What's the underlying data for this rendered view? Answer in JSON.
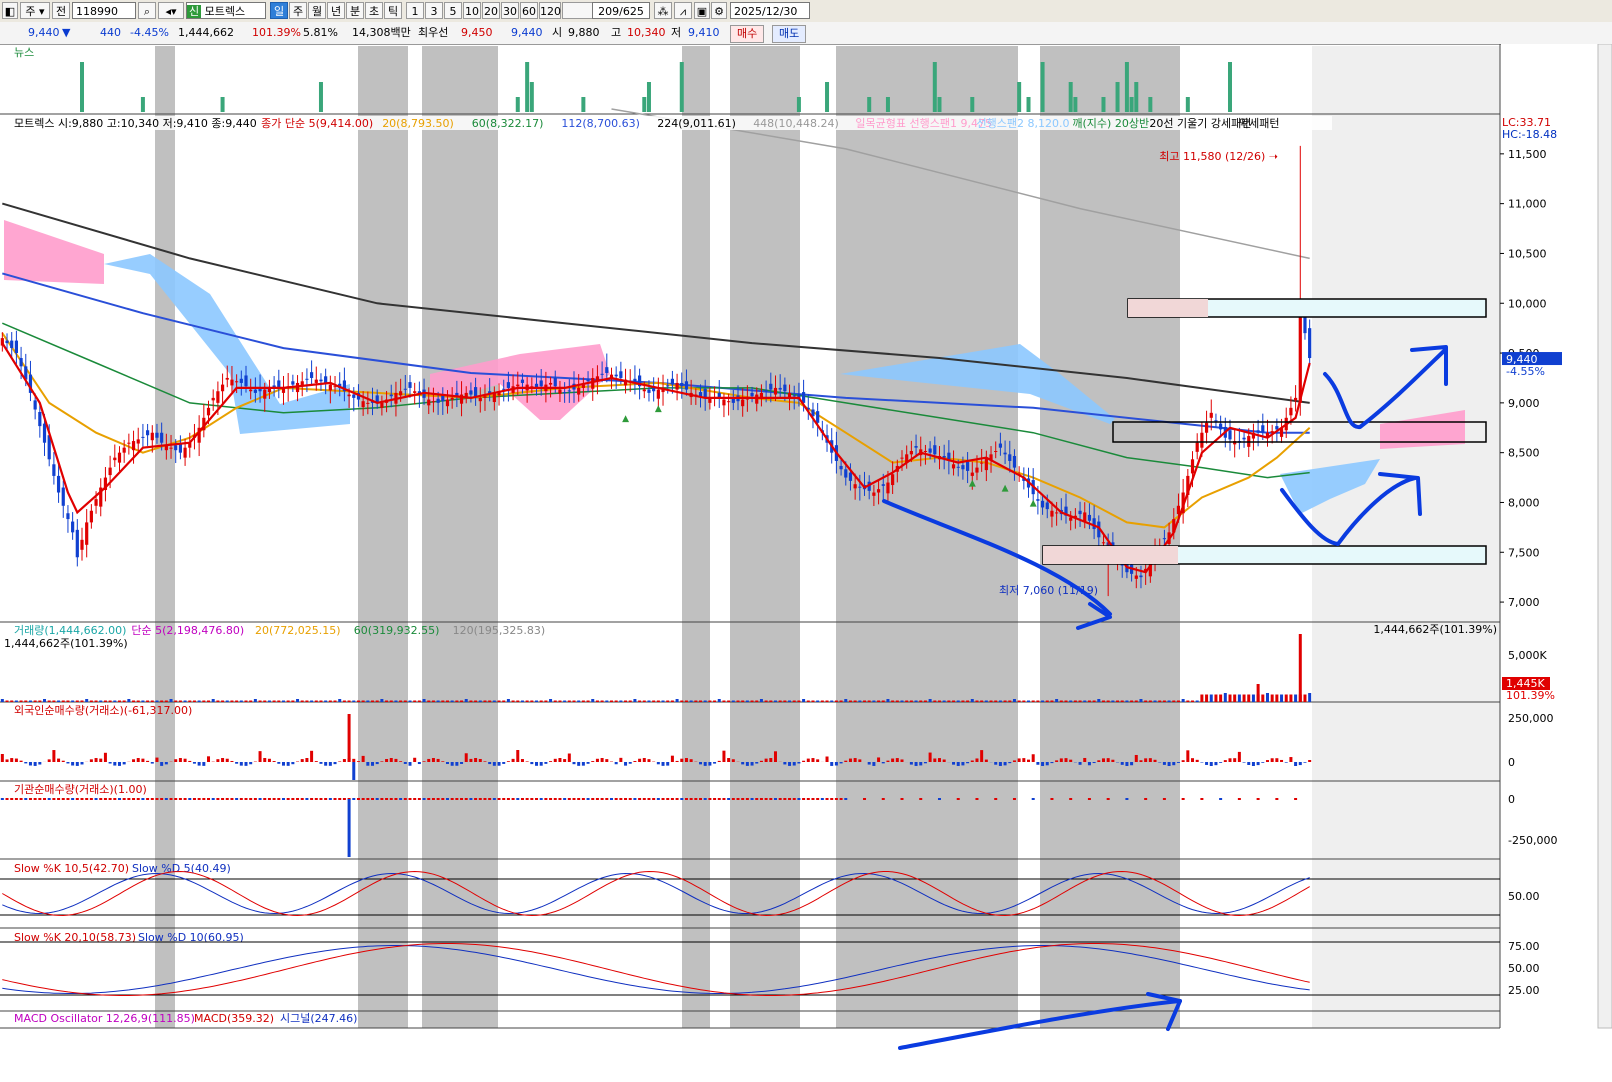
{
  "toolbar": {
    "items": [
      "주",
      "전",
      "118990",
      "모트렉스",
      "일",
      "주",
      "월",
      "년",
      "분",
      "초",
      "틱",
      "1",
      "3",
      "5",
      "10",
      "20",
      "30",
      "60",
      "120"
    ],
    "code": "118990",
    "name": "모트렉스",
    "name_prefix": "신",
    "periods": [
      "일",
      "주",
      "월",
      "년",
      "분",
      "초",
      "틱"
    ],
    "intervals": [
      "1",
      "3",
      "5",
      "10",
      "20",
      "30",
      "60",
      "120"
    ],
    "count": "209/625",
    "date": "2025/12/30"
  },
  "quote": {
    "price": "9,440",
    "change": "440",
    "change_pct": "-4.45%",
    "volume": "1,444,662",
    "vol_ratio": "101.39%",
    "turnover_pct": "5.81%",
    "amount": "14,308백만",
    "best_ask_label": "최우선",
    "best_ask": "9,450",
    "best_bid": "9,440",
    "open_label": "시",
    "open": "9,880",
    "high_label": "고",
    "high": "10,340",
    "low_label": "저",
    "low": "9,410",
    "buy": "매수",
    "sell": "매도"
  },
  "panels": {
    "news": "뉴스",
    "price_legend": [
      {
        "text": "모트렉스 시:9,880 고:10,340 저:9,410 종:9,440",
        "color": "#000000"
      },
      {
        "text": "종가 단순 5(9,414.00)",
        "color": "#d00000"
      },
      {
        "text": "20(8,793.50)",
        "color": "#e8a000"
      },
      {
        "text": "60(8,322.17)",
        "color": "#1a8a3a"
      },
      {
        "text": "112(8,700.63)",
        "color": "#2a4fd8"
      },
      {
        "text": "224(9,011.61)",
        "color": "#000000"
      },
      {
        "text": "448(10,448.24)",
        "color": "#999999"
      },
      {
        "text": "일목균형표 선행스팬1 9,475",
        "color": "#ff9ccc"
      },
      {
        "text": "선행스팬2 8,120.0",
        "color": "#8cc8ff"
      },
      {
        "text": "깨(지수) 20상반",
        "color": "#1a8a3a"
      },
      {
        "text": "20선 기울기 강세패턴",
        "color": "#000000"
      },
      {
        "text": "약세패턴",
        "color": "#000000"
      }
    ],
    "high_note": "최고 11,580 (12/26)",
    "low_note": "최저 7,060 (11/19)",
    "lc": "LC:33.71",
    "hc": "HC:-18.48",
    "price_tag": "9,440",
    "price_tag_pct": "-4.55%",
    "volume_legend": [
      {
        "text": "거래량(1,444,662.00)",
        "color": "#1aa6a6"
      },
      {
        "text": "단순 5(2,198,476.80)",
        "color": "#c000c0"
      },
      {
        "text": "20(772,025.15)",
        "color": "#e8a000"
      },
      {
        "text": "60(319,932.55)",
        "color": "#1a8a3a"
      },
      {
        "text": "120(195,325.83)",
        "color": "#888888"
      }
    ],
    "volume_sub": "1,444,662주(101.39%)",
    "volume_right": "1,444,662주(101.39%)",
    "volume_tag": "1,445K",
    "volume_tag_pct": "101.39%",
    "foreign_legend": "외국인순매수량(거래소)(-61,317.00)",
    "inst_legend": "기관순매수량(거래소)(1.00)",
    "stoch1_k": "Slow %K 10,5(42.70)",
    "stoch1_d": "Slow %D 5(40.49)",
    "stoch2_k": "Slow %K 20,10(58.73)",
    "stoch2_d": "Slow %D 10(60.95)",
    "macd_osc": "MACD Oscillator 12,26,9(111.85)",
    "macd": "MACD(359.32)",
    "macd_signal": "시그널(247.46)"
  },
  "chart_data": {
    "type": "candlestick",
    "symbol": "모트렉스",
    "price_axis": {
      "ticks": [
        11500,
        11000,
        10500,
        10000,
        9500,
        9000,
        8500,
        8000,
        7500,
        7000
      ],
      "range": [
        6800,
        11900
      ]
    },
    "last": {
      "open": 9880,
      "high": 10340,
      "low": 9410,
      "close": 9440
    },
    "extremes": {
      "high": 11580,
      "high_date": "12/26",
      "low": 7060,
      "low_date": "11/19"
    },
    "moving_averages": [
      {
        "name": "5",
        "value": 9414.0,
        "color": "#d00000"
      },
      {
        "name": "20",
        "value": 8793.5,
        "color": "#e8a000"
      },
      {
        "name": "60",
        "value": 8322.17,
        "color": "#1a8a3a"
      },
      {
        "name": "112",
        "value": 8700.63,
        "color": "#2a4fd8"
      },
      {
        "name": "224",
        "value": 9011.61,
        "color": "#000000"
      },
      {
        "name": "448",
        "value": 10448.24,
        "color": "#999999"
      }
    ],
    "volume_axis": {
      "ticks": [
        "5,000K"
      ]
    },
    "foreign_axis": {
      "ticks": [
        "250,000",
        "0"
      ]
    },
    "inst_axis": {
      "ticks": [
        "0",
        "-250,000"
      ]
    },
    "stoch1_axis": {
      "ticks": [
        "50.00"
      ]
    },
    "stoch2_axis": {
      "ticks": [
        "75.00",
        "50.00",
        "25.00"
      ]
    },
    "close_path": [
      [
        0,
        9650
      ],
      [
        3,
        9500
      ],
      [
        6,
        9100
      ],
      [
        9,
        8600
      ],
      [
        12,
        8100
      ],
      [
        15,
        7700
      ],
      [
        16,
        7450
      ],
      [
        18,
        7800
      ],
      [
        21,
        8150
      ],
      [
        24,
        8450
      ],
      [
        27,
        8600
      ],
      [
        30,
        8650
      ],
      [
        32,
        8700
      ],
      [
        34,
        8600
      ],
      [
        36,
        8550
      ],
      [
        38,
        8500
      ],
      [
        40,
        8600
      ],
      [
        42,
        8750
      ],
      [
        45,
        9050
      ],
      [
        48,
        9250
      ],
      [
        51,
        9200
      ],
      [
        54,
        9100
      ],
      [
        57,
        9150
      ],
      [
        60,
        9150
      ],
      [
        63,
        9200
      ],
      [
        66,
        9250
      ],
      [
        69,
        9200
      ],
      [
        72,
        9150
      ],
      [
        75,
        9050
      ],
      [
        78,
        9000
      ],
      [
        81,
        9000
      ],
      [
        84,
        9100
      ],
      [
        87,
        9150
      ],
      [
        90,
        9050
      ],
      [
        93,
        9000
      ],
      [
        96,
        9050
      ],
      [
        99,
        9100
      ],
      [
        102,
        9050
      ],
      [
        105,
        9100
      ],
      [
        108,
        9150
      ],
      [
        111,
        9200
      ],
      [
        114,
        9150
      ],
      [
        117,
        9200
      ],
      [
        120,
        9100
      ],
      [
        123,
        9150
      ],
      [
        126,
        9250
      ],
      [
        129,
        9300
      ],
      [
        132,
        9250
      ],
      [
        135,
        9200
      ],
      [
        138,
        9100
      ],
      [
        141,
        9150
      ],
      [
        144,
        9200
      ],
      [
        147,
        9100
      ],
      [
        150,
        9050
      ],
      [
        153,
        9050
      ],
      [
        156,
        9000
      ],
      [
        159,
        9050
      ],
      [
        162,
        9100
      ],
      [
        165,
        9150
      ],
      [
        168,
        9100
      ],
      [
        171,
        9000
      ],
      [
        174,
        8800
      ],
      [
        177,
        8500
      ],
      [
        180,
        8250
      ],
      [
        183,
        8150
      ],
      [
        186,
        8100
      ],
      [
        189,
        8200
      ],
      [
        192,
        8450
      ],
      [
        195,
        8550
      ],
      [
        198,
        8500
      ],
      [
        201,
        8450
      ],
      [
        204,
        8350
      ],
      [
        207,
        8300
      ],
      [
        210,
        8450
      ],
      [
        213,
        8550
      ],
      [
        216,
        8350
      ],
      [
        219,
        8150
      ],
      [
        222,
        7950
      ],
      [
        225,
        7900
      ],
      [
        228,
        7850
      ],
      [
        231,
        7900
      ],
      [
        234,
        7650
      ],
      [
        237,
        7500
      ],
      [
        240,
        7300
      ],
      [
        243,
        7250
      ],
      [
        246,
        7500
      ],
      [
        249,
        7700
      ],
      [
        252,
        8100
      ],
      [
        255,
        8600
      ],
      [
        258,
        8900
      ],
      [
        261,
        8650
      ],
      [
        264,
        8600
      ],
      [
        267,
        8700
      ],
      [
        270,
        8700
      ],
      [
        273,
        8750
      ],
      [
        276,
        9050
      ],
      [
        277,
        9950
      ],
      [
        279,
        9450
      ]
    ],
    "ma5_path": [
      [
        0,
        9600
      ],
      [
        8,
        9000
      ],
      [
        14,
        8100
      ],
      [
        16,
        7900
      ],
      [
        22,
        8150
      ],
      [
        30,
        8550
      ],
      [
        40,
        8600
      ],
      [
        50,
        9150
      ],
      [
        60,
        9150
      ],
      [
        70,
        9200
      ],
      [
        80,
        9000
      ],
      [
        90,
        9100
      ],
      [
        100,
        9050
      ],
      [
        110,
        9150
      ],
      [
        120,
        9150
      ],
      [
        130,
        9250
      ],
      [
        140,
        9150
      ],
      [
        150,
        9050
      ],
      [
        160,
        9050
      ],
      [
        170,
        9050
      ],
      [
        178,
        8500
      ],
      [
        184,
        8150
      ],
      [
        190,
        8300
      ],
      [
        196,
        8500
      ],
      [
        204,
        8400
      ],
      [
        210,
        8450
      ],
      [
        218,
        8250
      ],
      [
        226,
        7900
      ],
      [
        234,
        7750
      ],
      [
        240,
        7350
      ],
      [
        244,
        7300
      ],
      [
        250,
        7700
      ],
      [
        256,
        8500
      ],
      [
        262,
        8750
      ],
      [
        270,
        8650
      ],
      [
        276,
        8850
      ],
      [
        279,
        9400
      ]
    ],
    "ma20_path": [
      [
        0,
        9700
      ],
      [
        10,
        9000
      ],
      [
        20,
        8700
      ],
      [
        30,
        8500
      ],
      [
        40,
        8650
      ],
      [
        50,
        8950
      ],
      [
        60,
        9150
      ],
      [
        80,
        9100
      ],
      [
        100,
        9050
      ],
      [
        120,
        9150
      ],
      [
        140,
        9200
      ],
      [
        160,
        9050
      ],
      [
        170,
        9000
      ],
      [
        180,
        8700
      ],
      [
        190,
        8400
      ],
      [
        200,
        8450
      ],
      [
        210,
        8400
      ],
      [
        220,
        8250
      ],
      [
        230,
        8050
      ],
      [
        240,
        7800
      ],
      [
        248,
        7750
      ],
      [
        256,
        8050
      ],
      [
        266,
        8250
      ],
      [
        272,
        8450
      ],
      [
        279,
        8750
      ]
    ],
    "ma60_path": [
      [
        0,
        9800
      ],
      [
        20,
        9400
      ],
      [
        40,
        9000
      ],
      [
        60,
        8900
      ],
      [
        80,
        8950
      ],
      [
        100,
        9050
      ],
      [
        120,
        9100
      ],
      [
        140,
        9150
      ],
      [
        160,
        9150
      ],
      [
        180,
        9000
      ],
      [
        200,
        8850
      ],
      [
        220,
        8700
      ],
      [
        240,
        8450
      ],
      [
        256,
        8350
      ],
      [
        270,
        8250
      ],
      [
        279,
        8300
      ]
    ],
    "ma112_path": [
      [
        0,
        10300
      ],
      [
        30,
        9900
      ],
      [
        60,
        9550
      ],
      [
        100,
        9300
      ],
      [
        140,
        9200
      ],
      [
        180,
        9050
      ],
      [
        220,
        8950
      ],
      [
        250,
        8800
      ],
      [
        270,
        8700
      ],
      [
        279,
        8700
      ]
    ],
    "ma224_path": [
      [
        0,
        11000
      ],
      [
        40,
        10450
      ],
      [
        80,
        10000
      ],
      [
        120,
        9800
      ],
      [
        160,
        9600
      ],
      [
        200,
        9450
      ],
      [
        240,
        9250
      ],
      [
        279,
        9000
      ]
    ],
    "ma448_path": [
      [
        130,
        11950
      ],
      [
        180,
        11550
      ],
      [
        230,
        10950
      ],
      [
        279,
        10450
      ]
    ]
  }
}
